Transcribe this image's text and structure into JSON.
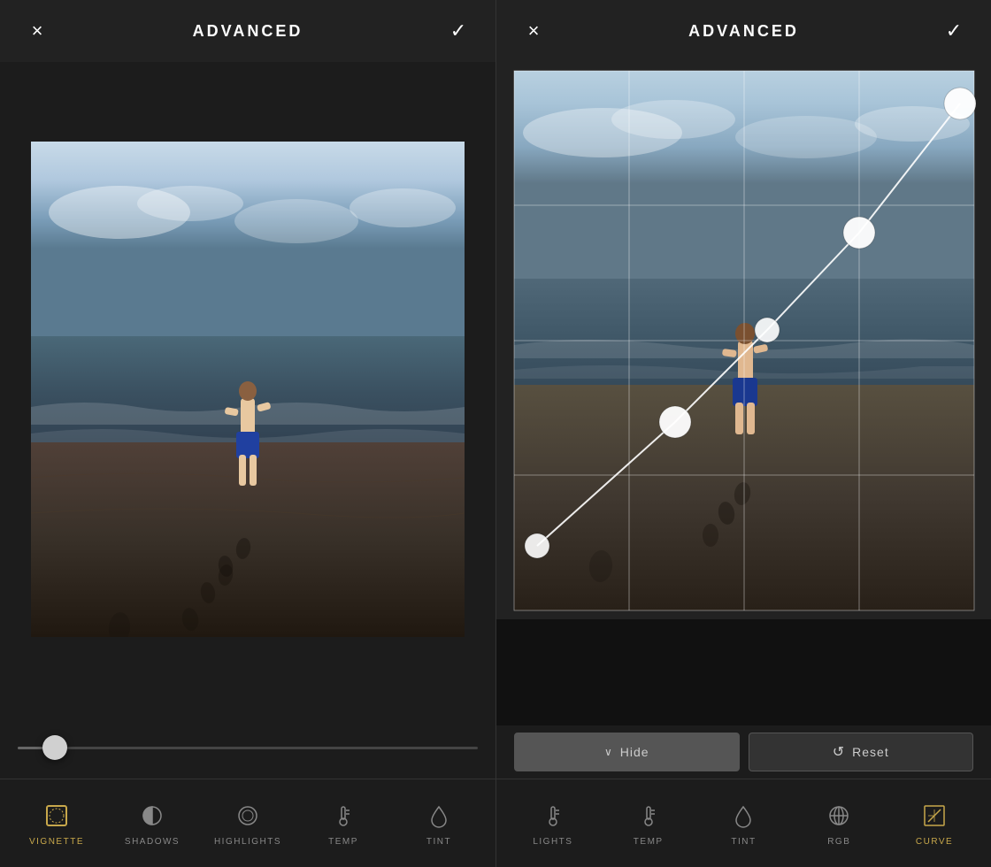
{
  "left_panel": {
    "header": {
      "title": "ADVANCED",
      "close_label": "×",
      "confirm_label": "✓"
    },
    "toolbar": {
      "items": [
        {
          "id": "vignette",
          "label": "VIGNETTE",
          "active": true
        },
        {
          "id": "shadows",
          "label": "SHADOWS",
          "active": false
        },
        {
          "id": "highlights",
          "label": "HIGHLIGHTS",
          "active": false
        },
        {
          "id": "temp",
          "label": "TEMP",
          "active": false
        },
        {
          "id": "tint",
          "label": "TINT",
          "active": false
        }
      ]
    },
    "slider": {
      "value": 8,
      "min": 0,
      "max": 100
    }
  },
  "right_panel": {
    "header": {
      "title": "ADVANCED",
      "close_label": "×",
      "confirm_label": "✓"
    },
    "toolbar": {
      "items": [
        {
          "id": "lights",
          "label": "LIGHTS",
          "active": false
        },
        {
          "id": "temp",
          "label": "TEMP",
          "active": false
        },
        {
          "id": "tint",
          "label": "TINT",
          "active": false
        },
        {
          "id": "rgb",
          "label": "RGB",
          "active": false
        },
        {
          "id": "curve",
          "label": "CURVE",
          "active": true
        }
      ]
    },
    "buttons": {
      "hide_label": "Hide",
      "reset_label": "Reset"
    },
    "curve": {
      "points": [
        {
          "x": 0.05,
          "y": 0.88
        },
        {
          "x": 0.35,
          "y": 0.62
        },
        {
          "x": 0.55,
          "y": 0.43
        },
        {
          "x": 0.75,
          "y": 0.28
        },
        {
          "x": 0.97,
          "y": 0.05
        }
      ]
    }
  },
  "icons": {
    "close": "×",
    "check": "✓",
    "chevron_down": "❮",
    "reset": "↺",
    "hide_arrow": "∨"
  }
}
